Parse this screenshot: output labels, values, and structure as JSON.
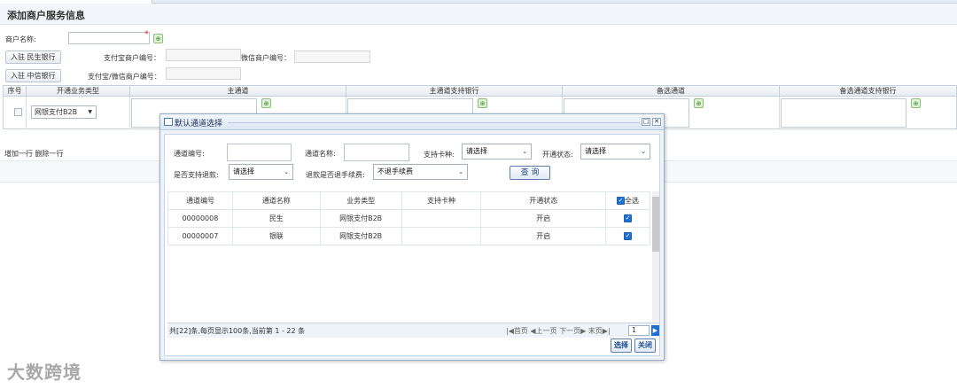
{
  "page": {
    "title": "添加商户服务信息"
  },
  "form": {
    "merchant_name_label": "商户名称:",
    "required_mark": "*",
    "alipay_no_label": "支付宝商户编号：",
    "wechat_no_label": "微信商户编号：",
    "alipay_wechat_no_label": "支付宝/微信商户编号：",
    "btn_minsheng": "入驻  民生银行",
    "btn_zhongxin": "入驻  中信银行"
  },
  "grid": {
    "headers": [
      "序号",
      "开通业务类型",
      "主通道",
      "主通道支持银行",
      "备选通道",
      "备选通道支持银行"
    ],
    "row_select": "网银支付B2B",
    "row_select_arrow": "▼"
  },
  "links": {
    "add_row": "增加一行",
    "delete_row": "删除一行"
  },
  "modal": {
    "title": "默认通道选择",
    "minimize": "□",
    "close": "✕",
    "filters": {
      "channel_no_label": "通道编号:",
      "channel_name_label": "通道名称:",
      "card_type_label": "支持卡种:",
      "card_type_value": "请选择",
      "status_label": "开通状态:",
      "status_value": "请选择",
      "refund_label": "是否支持退款:",
      "refund_value": "请选择",
      "refund_fee_label": "退款是否退手续费:",
      "refund_fee_value": "不退手续费",
      "query_button": "查 询"
    },
    "table": {
      "headers": [
        "通道编号",
        "通道名称",
        "业务类型",
        "支持卡种",
        "开通状态",
        "全选"
      ],
      "rows": [
        {
          "no": "00000008",
          "name": "民生",
          "type": "网银支付B2B",
          "card": "",
          "status": "开启"
        },
        {
          "no": "00000007",
          "name": "银联",
          "type": "网银支付B2B",
          "card": "",
          "status": "开启"
        }
      ]
    },
    "pager": {
      "info": "共[22]条,每页显示100条,当前第 1 - 22 条",
      "first": "|◀首页",
      "prev": "◀上一页",
      "next": "下一页▶",
      "last": "末页▶|",
      "page": "1"
    },
    "select_button": "选择",
    "close_button": "关闭"
  },
  "watermark": "大数跨境"
}
